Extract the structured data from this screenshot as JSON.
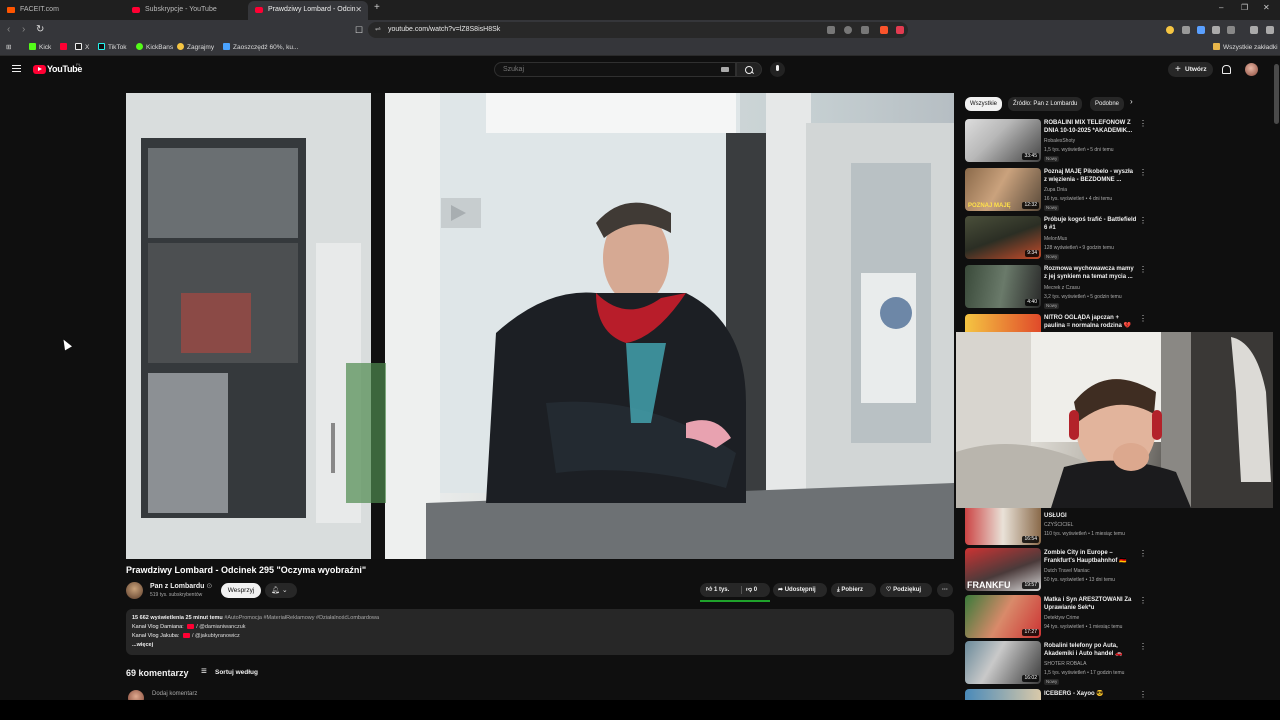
{
  "browser": {
    "tabs": [
      {
        "title": "FACEIT.com",
        "active": false
      },
      {
        "title": "Subskrypcje - YouTube",
        "active": false
      },
      {
        "title": "Prawdziwy Lombard - Odcin",
        "active": true
      }
    ],
    "new_tab": "+",
    "window_controls": [
      "–",
      "❐",
      "✕"
    ],
    "url": "youtube.com/watch?v=lZ8S8isH8Sk",
    "bookmarks": [
      {
        "label": "Kick",
        "color": "#53fc18"
      },
      {
        "label": "",
        "color": "#ff0033"
      },
      {
        "label": "X",
        "color": "#ffffff"
      },
      {
        "label": "TikTok",
        "color": "#ffffff"
      },
      {
        "label": "KickBans",
        "color": "#53fc18"
      },
      {
        "label": "Zagrajmy",
        "color": "#f5c542"
      },
      {
        "label": "Zaoszczędź 60%, ku...",
        "color": "#4aa3ff"
      }
    ],
    "all_bookmarks": "Wszystkie zakładki"
  },
  "youtube": {
    "logo": "YouTube",
    "region": "PL",
    "search_placeholder": "Szukaj",
    "create_label": "Utwórz",
    "accent": "#ff0033"
  },
  "video": {
    "title": "Prawdziwy Lombard - Odcinek 295 \"Oczyma wyobraźni\"",
    "channel": "Pan z Lombardu",
    "verified": "⊙",
    "subscribers": "519 tys. subskrybentów",
    "support_label": "Wesprzyj",
    "subscribed_caret": "⌄",
    "likes": "1 tys.",
    "dislikes": "0",
    "share_label": "Udostępnij",
    "download_label": "Pobierz",
    "thanks_label": "Podziękuj",
    "more": "···"
  },
  "description": {
    "stats": "15 662 wyświetlenia  25 minut temu",
    "hashtags": "#AutoPromocja #MateriałReklamowy #DziałalnośćLombardowa",
    "line2_label": "Kanał Vlog Damiana:",
    "line2_handle": "/ @damianiwanczuk",
    "line3_label": "Kanał Vlog Jakuba:",
    "line3_handle": "/ @jakubtyranowicz",
    "more": "...więcej"
  },
  "comments": {
    "count": "69 komentarzy",
    "sort_label": "Sortuj według",
    "add_placeholder": "Dodaj komentarz"
  },
  "chips": [
    "Wszystkie",
    "Źródło: Pan z Lombardu",
    "Podobne"
  ],
  "recommendations": [
    {
      "title1": "ROBALINI MIX TELEFONÓW Z",
      "title2": "DNIA 10-10-2025 *AKADEMIK...",
      "channel": "RobalesShoty",
      "meta": "1,5 tys. wyświetleń • 5 dni temu",
      "badge": "Nowy",
      "duration": "33:45"
    },
    {
      "title1": "Poznaj MAJĘ Pikobelo - wyszła",
      "title2": "z więzienia - BEZDOMNE ...",
      "channel": "Zupa Dnia",
      "meta": "16 tys. wyświetleń • 4 dni temu",
      "badge": "Nowy",
      "duration": "12:32"
    },
    {
      "title1": "Próbuje kogoś trafić - Battlefield",
      "title2": "6 #1",
      "channel": "MelonMus",
      "meta": "128 wyświetleń • 9 godzin temu",
      "badge": "Nowy",
      "duration": "9:34"
    },
    {
      "title1": "Rozmowa wychowawcza mamy",
      "title2": "z jej synkiem na temat mycia ...",
      "channel": "Mecrek z Czasu",
      "meta": "3,2 tys. wyświetleń • 5 godzin temu",
      "badge": "Nowy",
      "duration": "4:40"
    },
    {
      "title1": "NITRO OGLĄDA japczan +",
      "title2": "paulina = normalna rodzina 💔",
      "channel": "",
      "meta": "",
      "badge": "",
      "duration": ""
    },
    {
      "title1": "USŁUGI",
      "title2": "",
      "channel": "CZYŚCICIEL",
      "meta": "110 tys. wyświetleń • 1 miesiąc temu",
      "badge": "",
      "duration": "16:54"
    },
    {
      "title1": "Zombie City in Europe –",
      "title2": "Frankfurt's Hauptbahnhof 🇩🇪",
      "channel": "Dutch Travel Maniac",
      "meta": "50 tys. wyświetleń • 13 dni temu",
      "badge": "",
      "duration": "19:57"
    },
    {
      "title1": "Matka i Syn ARESZTOWANI Za",
      "title2": "Uprawianie Sek*u",
      "channel": "Detektyw Crime",
      "meta": "94 tys. wyświetleń • 1 miesiąc temu",
      "badge": "",
      "duration": "17:27"
    },
    {
      "title1": "Robalini telefony po Auta,",
      "title2": "Akademiki i Auto handel 🚗",
      "channel": "SHOTER ROBALA",
      "meta": "1,5 tys. wyświetleń • 17 godzin temu",
      "badge": "Nowy",
      "duration": "16:02"
    },
    {
      "title1": "ICEBERG - Xayoo 😎",
      "title2": "",
      "channel": "",
      "meta": "",
      "badge": "",
      "duration": ""
    }
  ],
  "thumb_texts": {
    "pozna_maje": "POZNAJ MAJĘ",
    "frankfurt": "FRANKFU"
  }
}
